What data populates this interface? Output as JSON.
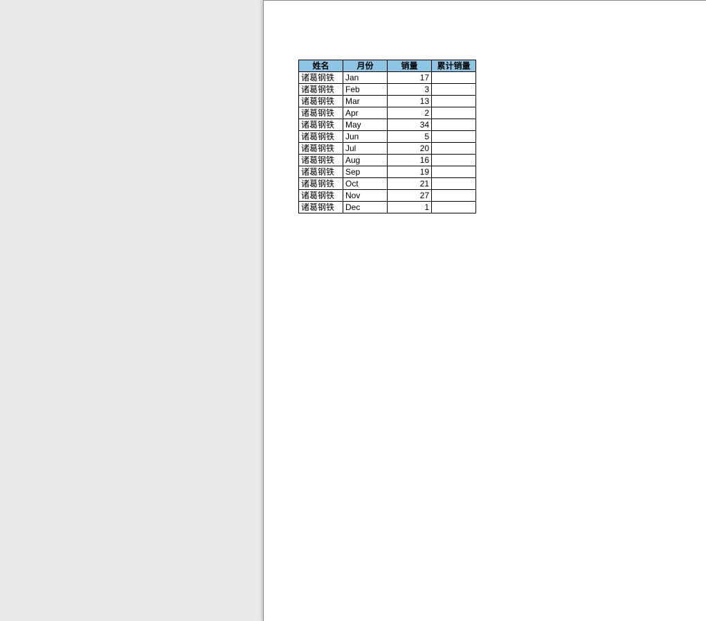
{
  "table": {
    "headers": {
      "name": "姓名",
      "month": "月份",
      "sales": "销量",
      "cumulative": "累计销量"
    },
    "rows": [
      {
        "name": "诸葛钢铁",
        "month": "Jan",
        "sales": "17",
        "cumulative": ""
      },
      {
        "name": "诸葛钢铁",
        "month": "Feb",
        "sales": "3",
        "cumulative": ""
      },
      {
        "name": "诸葛钢铁",
        "month": "Mar",
        "sales": "13",
        "cumulative": ""
      },
      {
        "name": "诸葛钢铁",
        "month": "Apr",
        "sales": "2",
        "cumulative": ""
      },
      {
        "name": "诸葛钢铁",
        "month": "May",
        "sales": "34",
        "cumulative": ""
      },
      {
        "name": "诸葛钢铁",
        "month": "Jun",
        "sales": "5",
        "cumulative": ""
      },
      {
        "name": "诸葛钢铁",
        "month": "Jul",
        "sales": "20",
        "cumulative": ""
      },
      {
        "name": "诸葛钢铁",
        "month": "Aug",
        "sales": "16",
        "cumulative": ""
      },
      {
        "name": "诸葛钢铁",
        "month": "Sep",
        "sales": "19",
        "cumulative": ""
      },
      {
        "name": "诸葛钢铁",
        "month": "Oct",
        "sales": "21",
        "cumulative": ""
      },
      {
        "name": "诸葛钢铁",
        "month": "Nov",
        "sales": "27",
        "cumulative": ""
      },
      {
        "name": "诸葛钢铁",
        "month": "Dec",
        "sales": "1",
        "cumulative": ""
      }
    ]
  },
  "colors": {
    "header_bg": "#8fc4e5",
    "border": "#000000",
    "page_bg": "#ffffff",
    "app_bg": "#e8e8e8"
  }
}
